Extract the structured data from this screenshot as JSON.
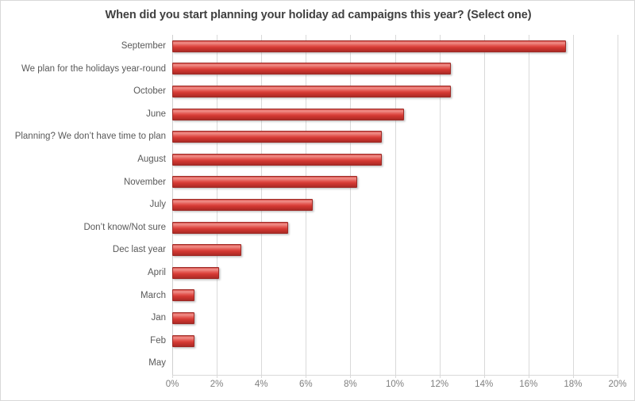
{
  "chart_data": {
    "type": "bar",
    "orientation": "horizontal",
    "title": "When did you start planning your holiday ad campaigns this year? (Select one)",
    "xlabel": "",
    "ylabel": "",
    "xlim": [
      0,
      20
    ],
    "x_tick_labels": [
      "0%",
      "2%",
      "4%",
      "6%",
      "8%",
      "10%",
      "12%",
      "14%",
      "16%",
      "18%",
      "20%"
    ],
    "x_tick_values": [
      0,
      2,
      4,
      6,
      8,
      10,
      12,
      14,
      16,
      18,
      20
    ],
    "grid": "vertical",
    "legend": "none",
    "series_color": "#e04038",
    "categories": [
      "September",
      "We plan for the holidays year-round",
      "October",
      "June",
      "Planning? We don’t have time to plan",
      "August",
      "November",
      "July",
      "Don’t know/Not  sure",
      "Dec last year",
      "April",
      "March",
      "Jan",
      "Feb",
      "May"
    ],
    "values": [
      17.7,
      12.5,
      12.5,
      10.4,
      9.4,
      9.4,
      8.3,
      6.3,
      5.2,
      3.1,
      2.1,
      1.0,
      1.0,
      1.0,
      0.0
    ]
  }
}
